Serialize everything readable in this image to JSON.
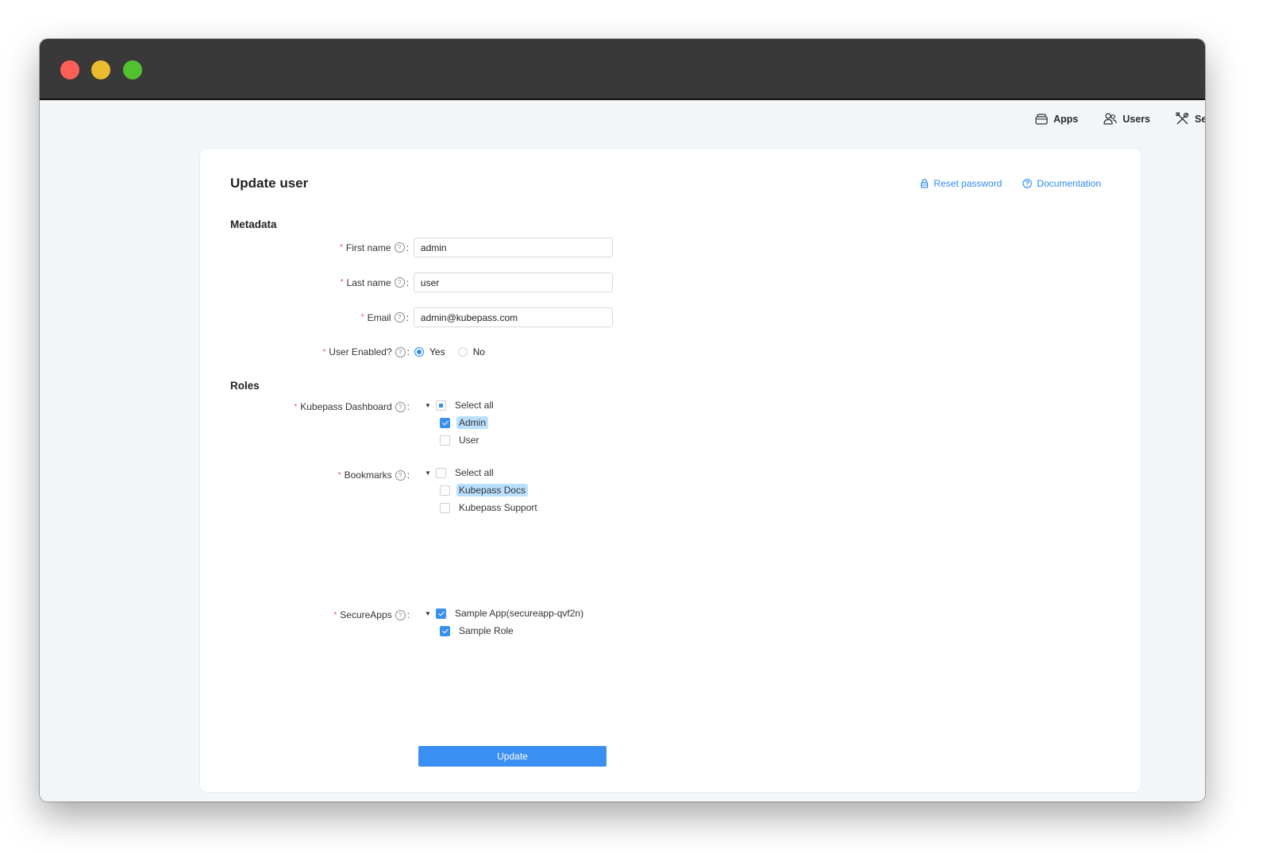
{
  "window": {
    "controls": [
      "close",
      "minimize",
      "maximize"
    ]
  },
  "nav": {
    "items": [
      {
        "icon": "apps-icon",
        "label": "Apps"
      },
      {
        "icon": "users-icon",
        "label": "Users"
      },
      {
        "icon": "settings-tools-icon",
        "label": "Set"
      }
    ]
  },
  "page": {
    "title": "Update user",
    "reset_password": "Reset password",
    "documentation": "Documentation"
  },
  "metadata": {
    "section_title": "Metadata",
    "first_name": {
      "label": "First name",
      "value": "admin"
    },
    "last_name": {
      "label": "Last name",
      "value": "user"
    },
    "email": {
      "label": "Email",
      "value": "admin@kubepass.com"
    },
    "user_enabled": {
      "label": "User Enabled?",
      "options": [
        "Yes",
        "No"
      ],
      "selected": "Yes"
    }
  },
  "roles": {
    "section_title": "Roles",
    "kubepass_dashboard": {
      "label": "Kubepass Dashboard",
      "parent": "Select all",
      "parent_state": "partial",
      "children": [
        {
          "label": "Admin",
          "checked": true,
          "highlighted": true
        },
        {
          "label": "User",
          "checked": false,
          "highlighted": false
        }
      ]
    },
    "bookmarks": {
      "label": "Bookmarks",
      "parent": "Select all",
      "parent_state": "unchecked",
      "children": [
        {
          "label": "Kubepass Docs",
          "checked": false,
          "highlighted": true
        },
        {
          "label": "Kubepass Support",
          "checked": false,
          "highlighted": false
        }
      ]
    },
    "secureapps": {
      "label": "SecureApps",
      "parent": "Sample App(secureapp-qvf2n)",
      "parent_state": "checked",
      "children": [
        {
          "label": "Sample Role",
          "checked": true,
          "highlighted": false
        }
      ]
    }
  },
  "submit": {
    "label": "Update"
  },
  "colors": {
    "accent": "#3a8ff3",
    "link": "#2f8cf0",
    "required": "#ff4d4f",
    "selection": "#bae0ff"
  }
}
